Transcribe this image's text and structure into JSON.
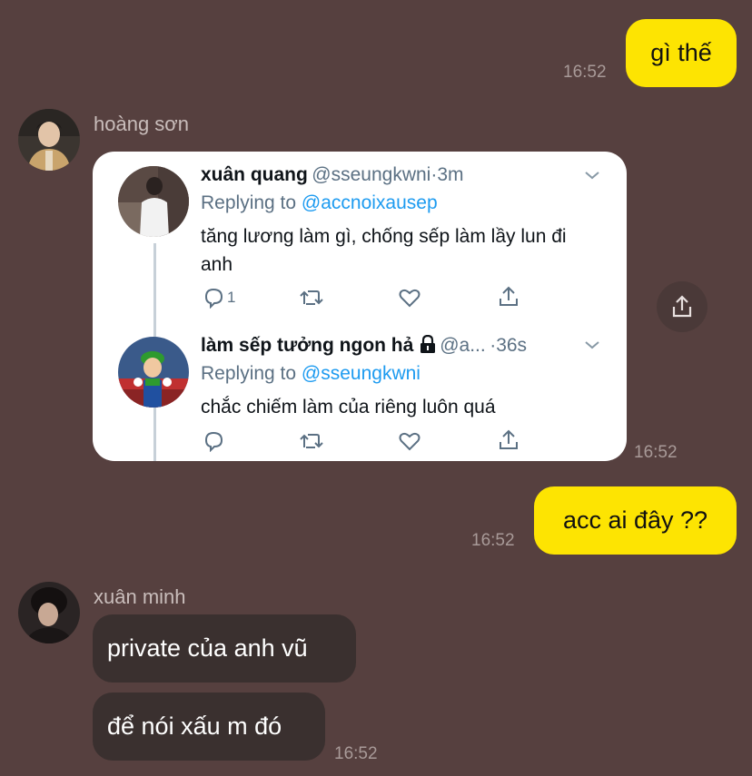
{
  "messages": {
    "m1": {
      "text": "gì thế",
      "time": "16:52"
    },
    "sender1": {
      "name": "hoàng sơn"
    },
    "tweet_time": "16:52",
    "m2": {
      "text": "acc ai đây ??",
      "time": "16:52"
    },
    "sender2": {
      "name": "xuân minh"
    },
    "m3": {
      "text": "private của anh vũ"
    },
    "m4": {
      "text": "để nói xấu m đó",
      "time": "16:52"
    }
  },
  "tweets": [
    {
      "name": "xuân quang",
      "handle": "@sseungkwni",
      "dot": "·",
      "age": "3m",
      "reply_prefix": "Replying to ",
      "reply_to": "@accnoixausep",
      "text": "tăng lương làm gì, chống sếp làm lầy lun đi anh",
      "reply_count": "1"
    },
    {
      "name": "làm sếp tưởng ngon hả",
      "handle": "@a...",
      "dot": "·",
      "age": "36s",
      "reply_prefix": "Replying to ",
      "reply_to": "@sseungkwni",
      "text": "chắc chiếm làm của riêng luôn quá"
    }
  ],
  "colors": {
    "background": "#56403f",
    "my_bubble": "#fde402",
    "their_bubble": "#3a302f",
    "twitter_link": "#1d9bf0"
  }
}
